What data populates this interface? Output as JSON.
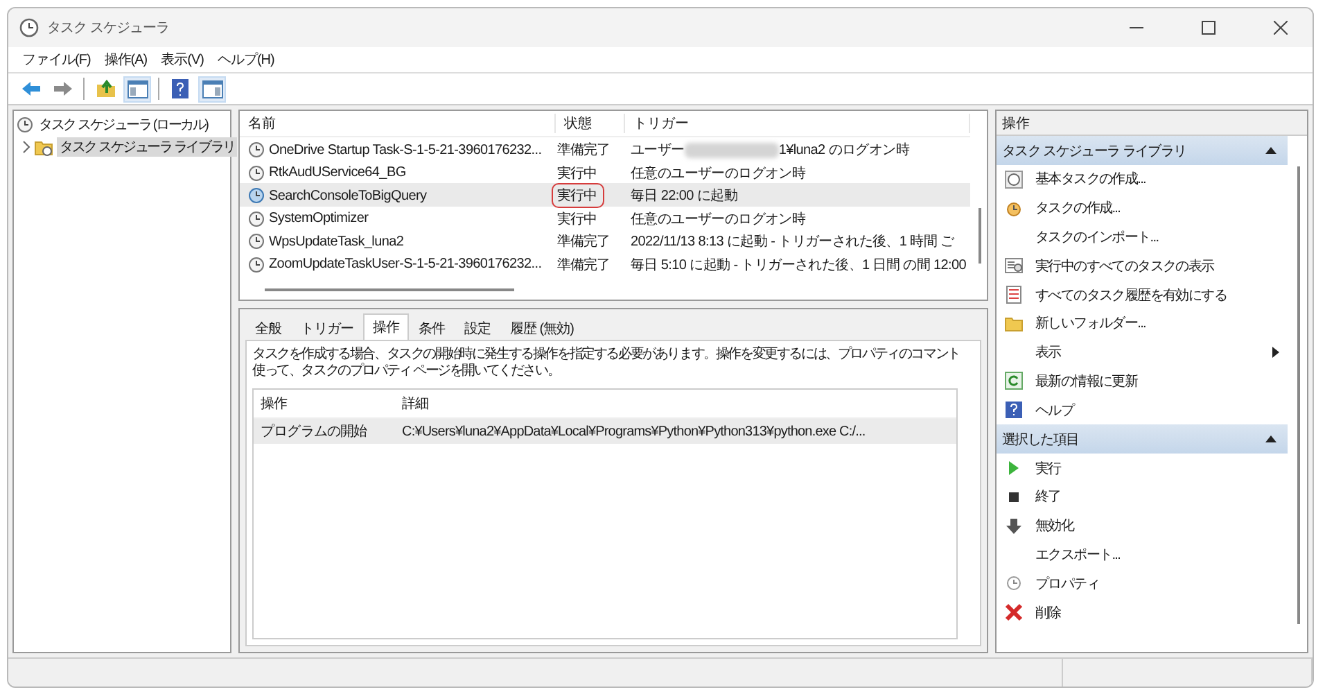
{
  "window": {
    "title": "タスク スケジューラ"
  },
  "menu": [
    "ファイル(F)",
    "操作(A)",
    "表示(V)",
    "ヘルプ(H)"
  ],
  "toolbar": [
    {
      "kind": "back",
      "pressed": false
    },
    {
      "kind": "forward",
      "pressed": false
    },
    {
      "kind": "sep"
    },
    {
      "kind": "up",
      "pressed": false
    },
    {
      "kind": "console",
      "pressed": true
    },
    {
      "kind": "sep"
    },
    {
      "kind": "help",
      "pressed": false
    },
    {
      "kind": "pane",
      "pressed": true
    }
  ],
  "tree": [
    {
      "label": "タスク スケジューラ (ローカル)",
      "selected": false,
      "children": [
        {
          "label": "タスク スケジューラ ライブラリ",
          "selected": true,
          "expanded": false
        }
      ]
    }
  ],
  "task_list": {
    "columns": [
      "名前",
      "状態",
      "トリガー"
    ],
    "rows": [
      {
        "name": "OneDrive Startup Task-S-1-5-21-3960176232...",
        "status": "準備完了",
        "trigger_prefix": "ユーザー",
        "redacted": true,
        "trigger": "1¥luna2 のログオン時",
        "selected": false,
        "highlighted": false
      },
      {
        "name": "RtkAudUService64_BG",
        "status": "実行中",
        "trigger": "任意のユーザーのログオン時",
        "selected": false,
        "highlighted": false
      },
      {
        "name": "SearchConsoleToBigQuery",
        "status": "実行中",
        "trigger": "毎日 22:00 に起動",
        "selected": true,
        "highlighted": true
      },
      {
        "name": "SystemOptimizer",
        "status": "実行中",
        "trigger": "任意のユーザーのログオン時",
        "selected": false,
        "highlighted": false
      },
      {
        "name": "WpsUpdateTask_luna2",
        "status": "準備完了",
        "trigger": "2022/11/13 8:13 に起動 - トリガーされた後、1 時間 ご",
        "selected": false,
        "highlighted": false
      },
      {
        "name": "ZoomUpdateTaskUser-S-1-5-21-3960176232...",
        "status": "準備完了",
        "trigger": "毎日 5:10 に起動 - トリガーされた後、1 日間 の間 12:00",
        "selected": false,
        "highlighted": false
      }
    ]
  },
  "detail_tabs": [
    {
      "label": "全般",
      "selected": false
    },
    {
      "label": "トリガー",
      "selected": false
    },
    {
      "label": "操作",
      "selected": true
    },
    {
      "label": "条件",
      "selected": false
    },
    {
      "label": "設定",
      "selected": false
    },
    {
      "label": "履歴 (無効)",
      "selected": false
    }
  ],
  "description": [
    "タスクを作成する場合、タスクの開始時に発生する操作を指定する必要があります。操作を変更するには、プロパティのコマント",
    "使って、タスクのプロパティ ページを開いてください。"
  ],
  "actions_table": {
    "columns": [
      "操作",
      "詳細"
    ],
    "rows": [
      {
        "action": "プログラムの開始",
        "detail": "C:¥Users¥luna2¥AppData¥Local¥Programs¥Python¥Python313¥python.exe C:/..."
      }
    ]
  },
  "actions_pane": {
    "title": "操作",
    "sections": [
      {
        "title": "タスク スケジューラ ライブラリ",
        "expanded": true,
        "items": [
          {
            "label": "基本タスクの作成...",
            "kind": "basic-task"
          },
          {
            "label": "タスクの作成...",
            "kind": "task"
          },
          {
            "label": "タスクのインポート...",
            "kind": "plain"
          },
          {
            "label": "実行中のすべてのタスクの表示",
            "kind": "running"
          },
          {
            "label": "すべてのタスク履歴を有効にする",
            "kind": "history"
          },
          {
            "label": "新しいフォルダー...",
            "kind": "folder"
          },
          {
            "label": "表示",
            "kind": "submenu"
          },
          {
            "label": "最新の情報に更新",
            "kind": "refresh"
          },
          {
            "label": "ヘルプ",
            "kind": "help"
          }
        ]
      },
      {
        "title": "選択した項目",
        "expanded": true,
        "items": [
          {
            "label": "実行",
            "kind": "run"
          },
          {
            "label": "終了",
            "kind": "stop"
          },
          {
            "label": "無効化",
            "kind": "disable"
          },
          {
            "label": "エクスポート...",
            "kind": "plain"
          },
          {
            "label": "プロパティ",
            "kind": "properties"
          },
          {
            "label": "削除",
            "kind": "delete"
          }
        ]
      }
    ]
  }
}
